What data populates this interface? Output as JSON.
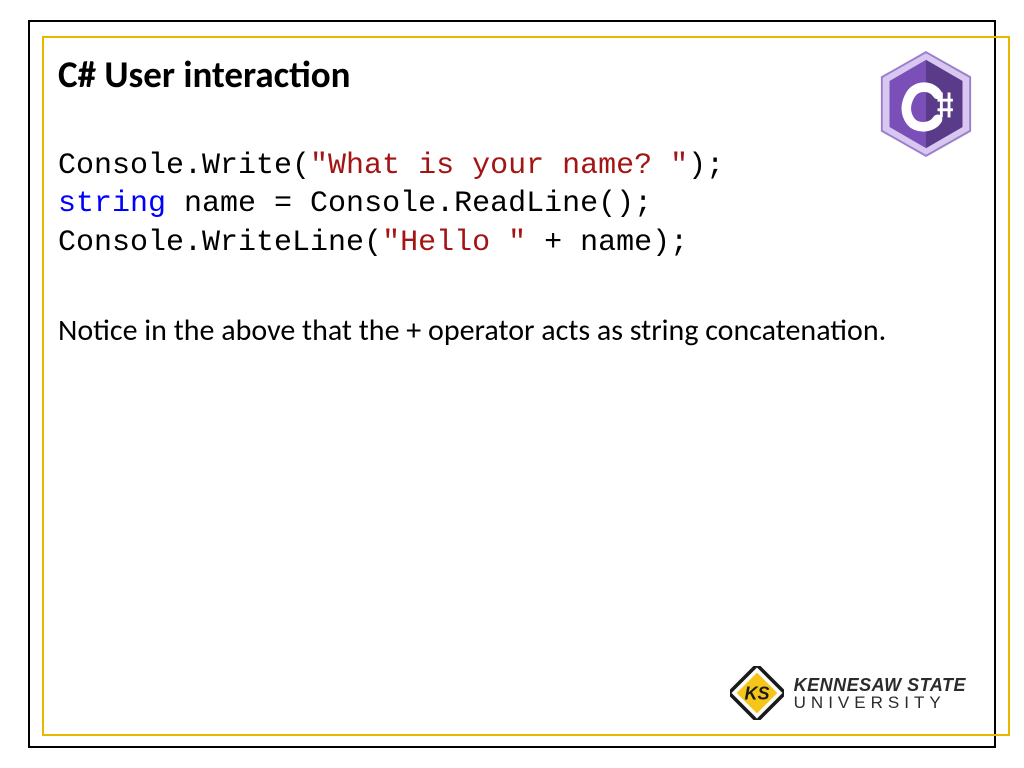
{
  "title": "C#  User interaction",
  "code": {
    "line1": {
      "p1": "Console.Write(",
      "str": "\"What is your name? \"",
      "p2": ");"
    },
    "line2": {
      "kw": "string",
      "rest": " name = Console.ReadLine();"
    },
    "line3": {
      "p1": "Console.WriteLine(",
      "str": "\"Hello \"",
      "p2": " + name);"
    }
  },
  "body_text": "Notice in the above that the + operator acts as string concatenation.",
  "logo": {
    "csharp_label": "C#",
    "university_line1": "KENNESAW STATE",
    "university_line2": "UNIVERSITY",
    "ks_mark": "KS"
  }
}
